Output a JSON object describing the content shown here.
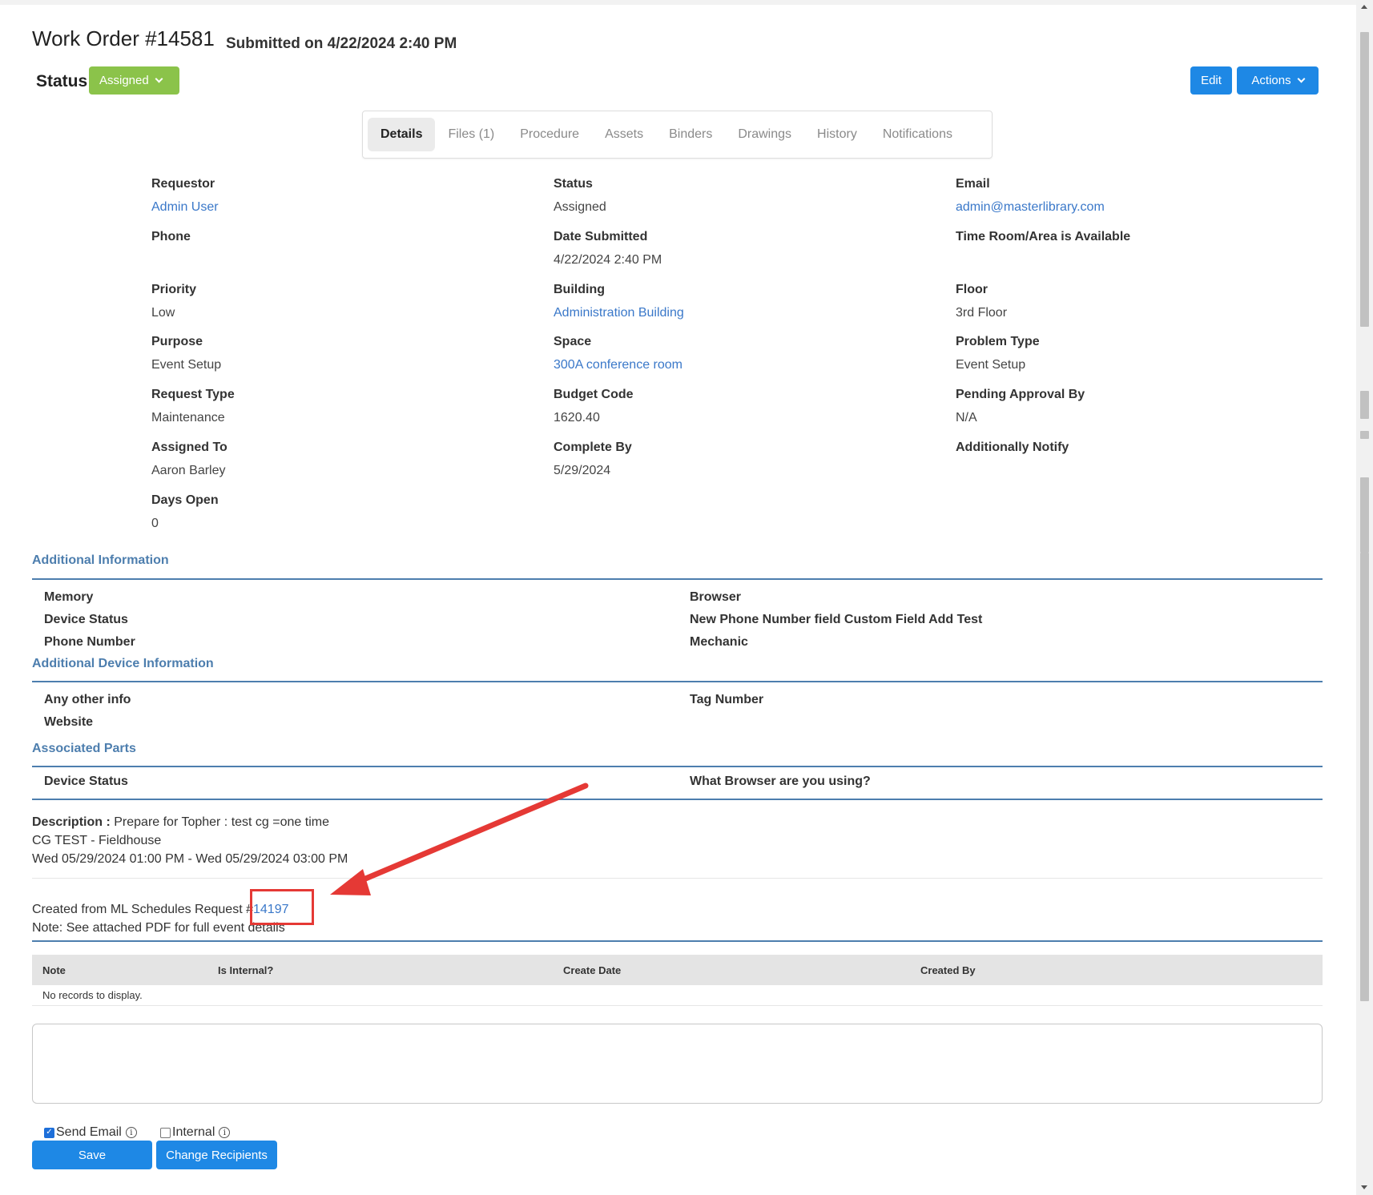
{
  "header": {
    "title": "Work Order #14581",
    "submitted": "Submitted on 4/22/2024 2:40 PM",
    "status_label": "Status",
    "status_value": "Assigned",
    "edit_label": "Edit",
    "actions_label": "Actions"
  },
  "tabs": [
    "Details",
    "Files (1)",
    "Procedure",
    "Assets",
    "Binders",
    "Drawings",
    "History",
    "Notifications"
  ],
  "details": {
    "requestor": {
      "label": "Requestor",
      "value": "Admin User"
    },
    "status": {
      "label": "Status",
      "value": "Assigned"
    },
    "email": {
      "label": "Email",
      "value": "admin@masterlibrary.com"
    },
    "phone": {
      "label": "Phone",
      "value": ""
    },
    "date_submitted": {
      "label": "Date Submitted",
      "value": "4/22/2024 2:40 PM"
    },
    "time_available": {
      "label": "Time Room/Area is Available",
      "value": ""
    },
    "priority": {
      "label": "Priority",
      "value": "Low"
    },
    "building": {
      "label": "Building",
      "value": "Administration Building"
    },
    "floor": {
      "label": "Floor",
      "value": "3rd Floor"
    },
    "purpose": {
      "label": "Purpose",
      "value": "Event Setup"
    },
    "space": {
      "label": "Space",
      "value": "300A conference room"
    },
    "problem_type": {
      "label": "Problem Type",
      "value": "Event Setup"
    },
    "request_type": {
      "label": "Request Type",
      "value": "Maintenance"
    },
    "budget_code": {
      "label": "Budget Code",
      "value": "1620.40"
    },
    "pending_approval": {
      "label": "Pending Approval By",
      "value": "N/A"
    },
    "assigned_to": {
      "label": "Assigned To",
      "value": "Aaron Barley"
    },
    "complete_by": {
      "label": "Complete By",
      "value": "5/29/2024"
    },
    "additionally_notify": {
      "label": "Additionally Notify",
      "value": ""
    },
    "days_open": {
      "label": "Days Open",
      "value": "0"
    }
  },
  "additional_info": {
    "title": "Additional Information",
    "left": [
      "Memory",
      "Device Status",
      "Phone Number"
    ],
    "right": [
      "Browser",
      "New Phone Number field Custom Field Add Test",
      "Mechanic"
    ]
  },
  "additional_device": {
    "title": "Additional Device Information",
    "left": [
      "Any other info",
      "Website"
    ],
    "right": [
      "Tag Number"
    ]
  },
  "associated_parts": {
    "title": "Associated Parts",
    "left": [
      "Device Status"
    ],
    "right": [
      "What Browser are you using?"
    ]
  },
  "description": {
    "label": "Description :",
    "line1": " Prepare for Topher : test cg =one time",
    "line2": "CG TEST - Fieldhouse",
    "line3": "Wed 05/29/2024 01:00 PM - Wed 05/29/2024 03:00 PM"
  },
  "created": {
    "prefix": "Created from ML Schedules Request #",
    "link": "14197",
    "note": "Note: See attached PDF for full event details"
  },
  "notes_grid": {
    "columns": [
      "Note",
      "Is Internal?",
      "Create Date",
      "Created By"
    ],
    "empty": "No records to display."
  },
  "footer": {
    "send_email": "Send Email",
    "send_email_checked": true,
    "internal": "Internal",
    "internal_checked": false,
    "save": "Save",
    "change_recipients": "Change Recipients"
  },
  "colors": {
    "accent_blue": "#1e88e5",
    "status_green": "#8bc34a",
    "section_blue": "#4d7eae",
    "link_blue": "#3a78c9",
    "annotation_red": "#e53935"
  }
}
